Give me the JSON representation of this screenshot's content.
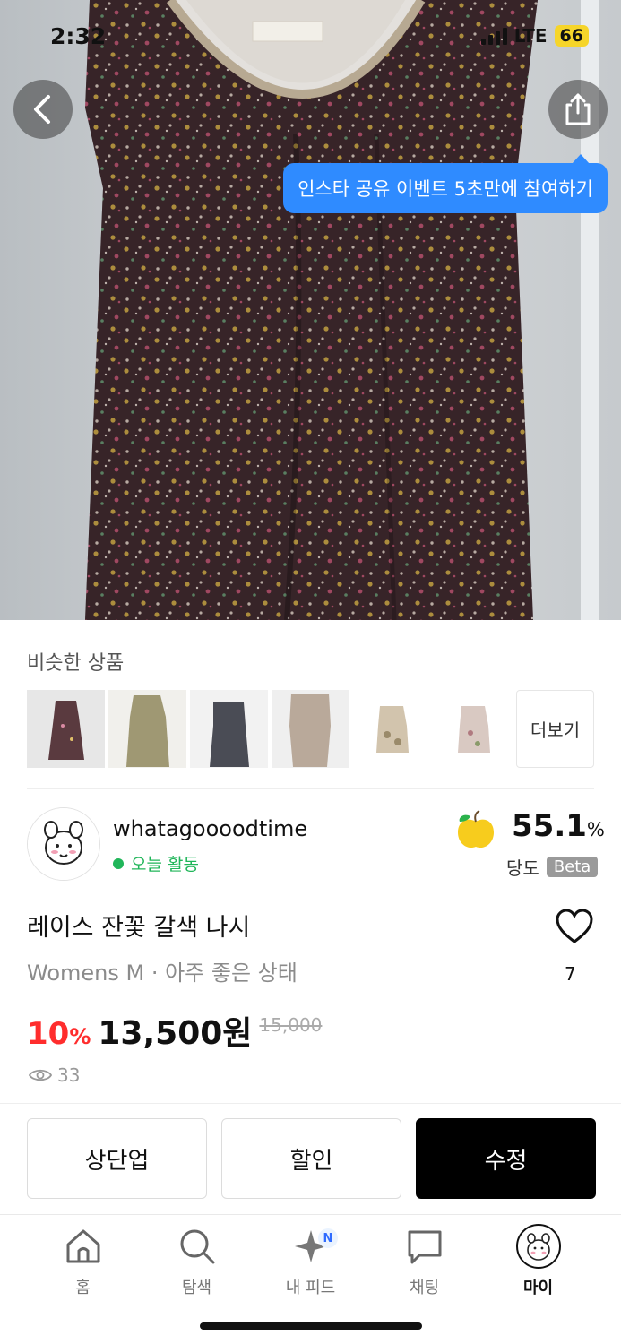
{
  "status_bar": {
    "time": "2:32",
    "network": "LTE",
    "battery": "66"
  },
  "tooltip": {
    "text": "인스타 공유 이벤트 5초만에 참여하기"
  },
  "similar": {
    "title": "비슷한 상품",
    "more_label": "더보기"
  },
  "seller": {
    "name": "whatagoooodtime",
    "activity": "오늘 활동",
    "score_value": "55.1",
    "score_unit": "%",
    "score_label": "당도",
    "beta_label": "Beta"
  },
  "product": {
    "title": "레이스 잔꽃 갈색 나시",
    "subtitle": "Womens M · 아주 좋은 상태",
    "discount_value": "10",
    "discount_unit": "%",
    "price": "13,500원",
    "original_price": "15,000",
    "likes": "7",
    "views": "33"
  },
  "actions": {
    "bump_label": "상단업",
    "discount_label": "할인",
    "edit_label": "수정"
  },
  "tabbar": {
    "items": [
      {
        "label": "홈",
        "icon": "home-icon"
      },
      {
        "label": "탐색",
        "icon": "search-icon"
      },
      {
        "label": "내 피드",
        "icon": "sparkle-icon",
        "badge": "N"
      },
      {
        "label": "채팅",
        "icon": "chat-icon"
      },
      {
        "label": "마이",
        "icon": "avatar-icon"
      }
    ]
  },
  "colors": {
    "accent_blue": "#2f8bff",
    "discount_red": "#ff2d2d",
    "online_green": "#21b65a",
    "primary_button": "#000000"
  }
}
